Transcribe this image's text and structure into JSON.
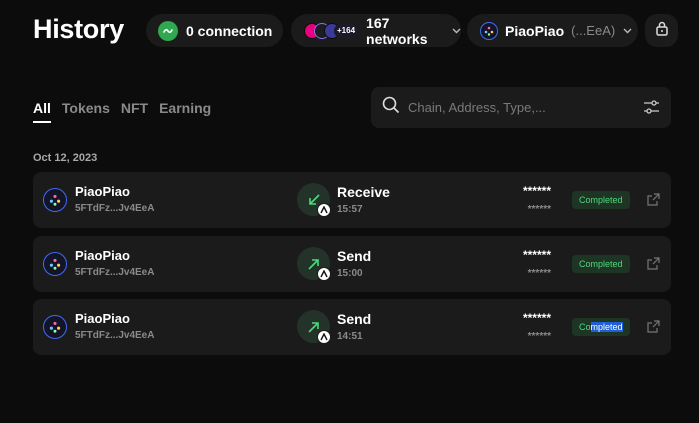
{
  "header": {
    "title": "History",
    "connection_label": "0 connection",
    "networks_label": "167 networks",
    "networks_badge": "+164",
    "account_name": "PiaoPiao",
    "account_addr": "(...EeA)"
  },
  "tabs": [
    {
      "label": "All",
      "active": true
    },
    {
      "label": "Tokens",
      "active": false
    },
    {
      "label": "NFT",
      "active": false
    },
    {
      "label": "Earning",
      "active": false
    }
  ],
  "search": {
    "placeholder": "Chain, Address, Type,..."
  },
  "date_group": "Oct 12, 2023",
  "transactions": [
    {
      "name": "PiaoPiao",
      "address": "5FTdFz...Jv4EeA",
      "type": "Receive",
      "time": "15:57",
      "amount": "******",
      "fee": "******",
      "status": "Completed",
      "direction": "in"
    },
    {
      "name": "PiaoPiao",
      "address": "5FTdFz...Jv4EeA",
      "type": "Send",
      "time": "15:00",
      "amount": "******",
      "fee": "******",
      "status": "Completed",
      "direction": "out"
    },
    {
      "name": "PiaoPiao",
      "address": "5FTdFz...Jv4EeA",
      "type": "Send",
      "time": "14:51",
      "amount": "******",
      "fee": "******",
      "status": "Completed",
      "direction": "out"
    }
  ],
  "colors": {
    "background": "#0c0c0c",
    "surface": "#1b1b1b",
    "status_green": "#4cd97b",
    "connection_green": "#2fa84f",
    "avatar_ring": "#3f6cf2",
    "selection_highlight": "#1f5fd6"
  },
  "icons": {
    "connection": "link-icon",
    "lock": "lock-icon",
    "search": "search-icon",
    "filter": "sliders-icon",
    "receive": "arrow-down-left-icon",
    "send": "arrow-up-right-icon",
    "external": "external-link-icon"
  }
}
